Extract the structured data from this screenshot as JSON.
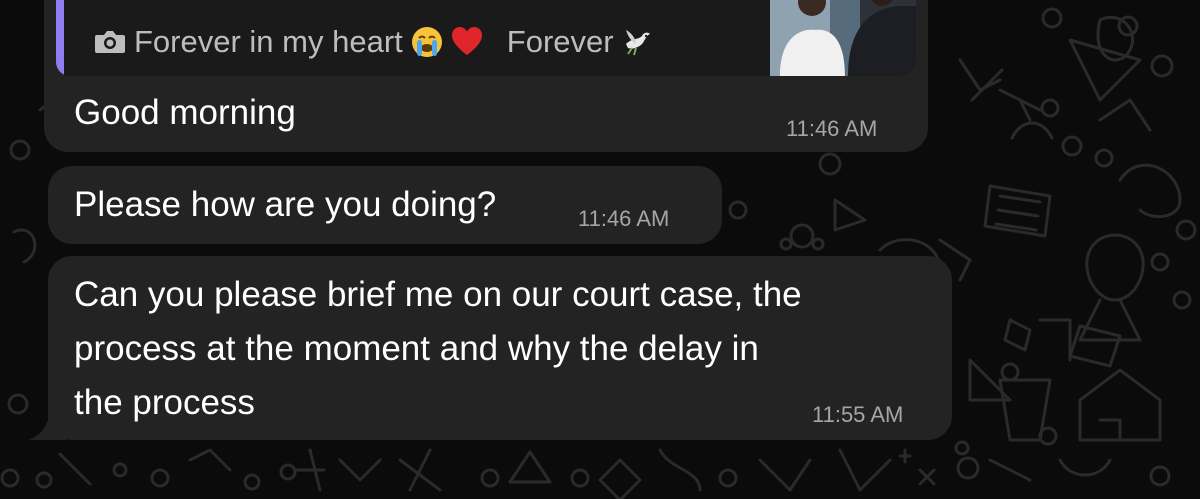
{
  "chat": {
    "reply_quote": {
      "media_label": "Forever in my heart",
      "suffix_label": "Forever",
      "media_icon": "camera-icon",
      "emojis": [
        "crying-face-emoji",
        "red-heart-emoji",
        "dove-emoji"
      ]
    },
    "messages": [
      {
        "text": "Good morning",
        "time": "11:46 AM"
      },
      {
        "text": "Please how are you doing?",
        "time": "11:46 AM"
      },
      {
        "text_lines": [
          "Can you please brief me on our court case, the",
          "process at the moment and why the delay in",
          "the process"
        ],
        "time": "11:55 AM"
      }
    ]
  },
  "colors": {
    "background": "#0b0b0b",
    "bubble": "#232323",
    "quote_accent": "#8e7ef0",
    "timestamp": "#a6a6a6"
  }
}
